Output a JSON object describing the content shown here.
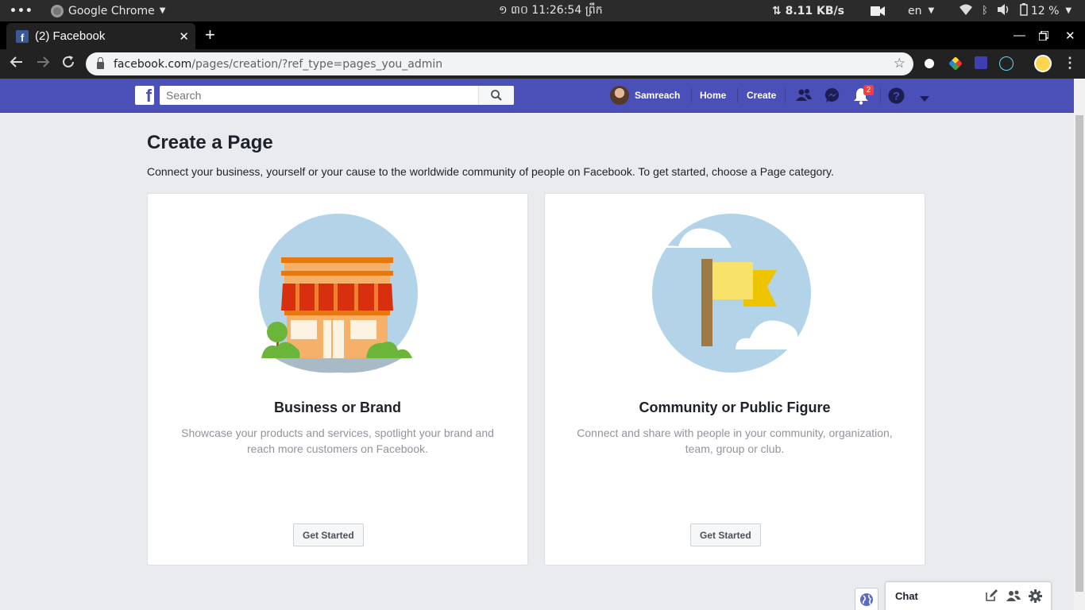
{
  "os": {
    "dots": "•••",
    "app_name": "Google Chrome",
    "clock": "១ ៣០ 11:26:54 ព្រឹក",
    "net_speed": "⇅ 8.11 KB/s",
    "lang": "en",
    "battery": "12 %"
  },
  "browser": {
    "tab_title": "(2) Facebook",
    "url_domain": "facebook.com",
    "url_path": "/pages/creation/?ref_type=pages_you_admin"
  },
  "fb": {
    "search_placeholder": "Search",
    "user_name": "Samreach",
    "home": "Home",
    "create": "Create",
    "notif_count": "2"
  },
  "page": {
    "title": "Create a Page",
    "subtitle": "Connect your business, yourself or your cause to the worldwide community of people on Facebook. To get started, choose a Page category.",
    "cards": [
      {
        "title": "Business or Brand",
        "desc": "Showcase your products and services, spotlight your brand and reach more customers on Facebook.",
        "button": "Get Started"
      },
      {
        "title": "Community or Public Figure",
        "desc": "Connect and share with people in your community, organization, team, group or club.",
        "button": "Get Started"
      }
    ]
  },
  "chat": {
    "label": "Chat"
  },
  "colors": {
    "fb_header": "#4b4fb8",
    "page_bg": "#e9ebee",
    "notif_badge": "#fa3e3e"
  }
}
